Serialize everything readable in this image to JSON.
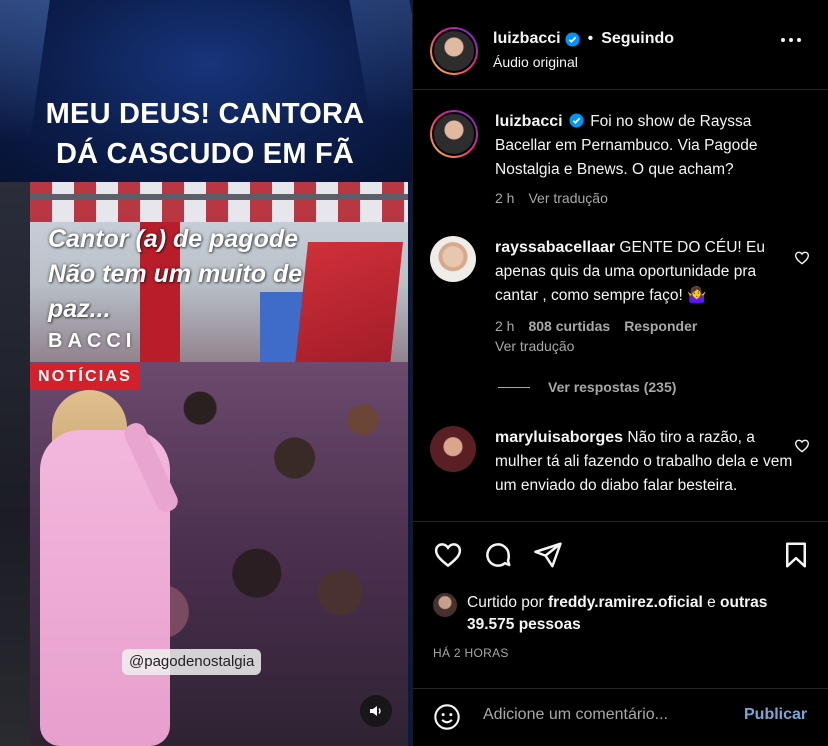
{
  "media": {
    "headline_line1": "MEU DEUS! CANTORA",
    "headline_line2": "DÁ CASCUDO EM FÃ",
    "overlay_line1": "Cantor (a) de pagode",
    "overlay_line2": "Não tem um muito de",
    "overlay_line3": "paz...",
    "brand_top": "BACCI",
    "brand_bottom": "NOTÍCIAS",
    "handle_tag": "@pagodenostalgia",
    "sound_icon": "speaker-icon"
  },
  "header": {
    "username": "luizbacci",
    "separator": "•",
    "follow_status": "Seguindo",
    "audio": "Áudio original"
  },
  "caption": {
    "username": "luizbacci",
    "text": "Foi no show de Rayssa Bacellar em Pernambuco. Via Pagode Nostalgia e Bnews. O que acham?",
    "time": "2 h",
    "translate": "Ver tradução"
  },
  "comments": [
    {
      "username": "rayssabacellaar",
      "text": "GENTE DO CÉU! Eu apenas quis da uma oportunidade pra cantar , como sempre faço! 🤷‍♀️",
      "time": "2 h",
      "likes": "808 curtidas",
      "reply": "Responder",
      "translate": "Ver tradução"
    },
    {
      "username": "maryluisaborges",
      "text": "Não tiro a razão, a mulher tá ali fazendo o trabalho dela e vem um enviado do diabo falar besteira."
    }
  ],
  "replies_label": "Ver respostas (235)",
  "likes": {
    "prefix": "Curtido por",
    "user": "freddy.ramirez.oficial",
    "conj": "e",
    "others": "outras 39.575 pessoas"
  },
  "time_ago": "HÁ 2 HORAS",
  "composer": {
    "placeholder": "Adicione um comentário...",
    "publish": "Publicar"
  },
  "colors": {
    "background": "#000000",
    "text": "#f5f5f5",
    "secondary": "#a8a8a8",
    "verified": "#0095f6",
    "publish": "#7aa6d6",
    "noticias_red": "#d4202a"
  }
}
